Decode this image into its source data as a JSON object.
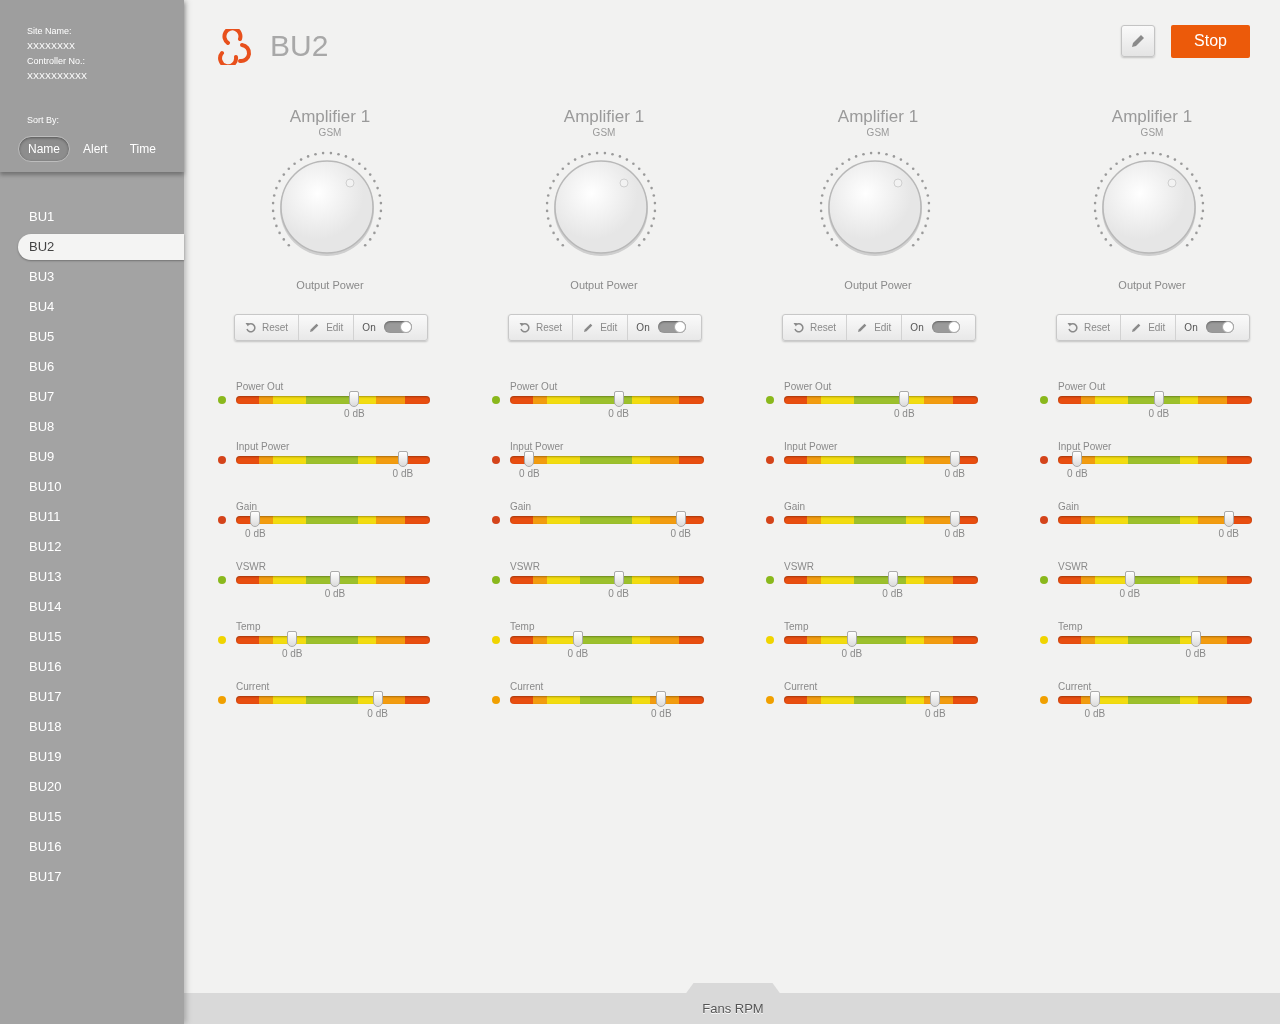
{
  "sidebar": {
    "site_label": "Site Name:",
    "site_value": "XXXXXXXX",
    "controller_label": "Controller No.:",
    "controller_value": "XXXXXXXXXX",
    "sort_label": "Sort By:",
    "sort_options": [
      {
        "label": "Name",
        "selected": true
      },
      {
        "label": "Alert",
        "selected": false
      },
      {
        "label": "Time",
        "selected": false
      }
    ],
    "items": [
      {
        "label": "BU1",
        "selected": false
      },
      {
        "label": "BU2",
        "selected": true
      },
      {
        "label": "BU3",
        "selected": false
      },
      {
        "label": "BU4",
        "selected": false
      },
      {
        "label": "BU5",
        "selected": false
      },
      {
        "label": "BU6",
        "selected": false
      },
      {
        "label": "BU7",
        "selected": false
      },
      {
        "label": "BU8",
        "selected": false
      },
      {
        "label": "BU9",
        "selected": false
      },
      {
        "label": "BU10",
        "selected": false
      },
      {
        "label": "BU11",
        "selected": false
      },
      {
        "label": "BU12",
        "selected": false
      },
      {
        "label": "BU13",
        "selected": false
      },
      {
        "label": "BU14",
        "selected": false
      },
      {
        "label": "BU15",
        "selected": false
      },
      {
        "label": "BU16",
        "selected": false
      },
      {
        "label": "BU17",
        "selected": false
      },
      {
        "label": "BU18",
        "selected": false
      },
      {
        "label": "BU19",
        "selected": false
      },
      {
        "label": "BU20",
        "selected": false
      },
      {
        "label": "BU15",
        "selected": false
      },
      {
        "label": "BU16",
        "selected": false
      },
      {
        "label": "BU17",
        "selected": false
      }
    ]
  },
  "header": {
    "title": "BU2",
    "stop_button": "Stop"
  },
  "amplifiers": [
    {
      "title": "Amplifier 1",
      "subtitle": "GSM",
      "knob_label": "Output Power",
      "reset": "Reset",
      "edit": "Edit",
      "toggle_label": "On",
      "on": true,
      "meters": [
        {
          "name": "Power Out",
          "color": "#8ab81c",
          "level": 0.61,
          "reading": "0 dB"
        },
        {
          "name": "Input Power",
          "color": "#d4441a",
          "level": 0.86,
          "reading": "0 dB"
        },
        {
          "name": "Gain",
          "color": "#d4441a",
          "level": 0.1,
          "reading": "0 dB"
        },
        {
          "name": "VSWR",
          "color": "#8ab81c",
          "level": 0.51,
          "reading": "0 dB"
        },
        {
          "name": "Temp",
          "color": "#f0d400",
          "level": 0.29,
          "reading": "0 dB"
        },
        {
          "name": "Current",
          "color": "#f0a000",
          "level": 0.73,
          "reading": "0 dB"
        }
      ]
    },
    {
      "title": "Amplifier 1",
      "subtitle": "GSM",
      "knob_label": "Output Power",
      "reset": "Reset",
      "edit": "Edit",
      "toggle_label": "On",
      "on": true,
      "meters": [
        {
          "name": "Power Out",
          "color": "#8ab81c",
          "level": 0.56,
          "reading": "0 dB"
        },
        {
          "name": "Input Power",
          "color": "#d4441a",
          "level": 0.1,
          "reading": "0 dB"
        },
        {
          "name": "Gain",
          "color": "#d4441a",
          "level": 0.88,
          "reading": "0 dB"
        },
        {
          "name": "VSWR",
          "color": "#8ab81c",
          "level": 0.56,
          "reading": "0 dB"
        },
        {
          "name": "Temp",
          "color": "#f0d400",
          "level": 0.35,
          "reading": "0 dB"
        },
        {
          "name": "Current",
          "color": "#f0a000",
          "level": 0.78,
          "reading": "0 dB"
        }
      ]
    },
    {
      "title": "Amplifier 1",
      "subtitle": "GSM",
      "knob_label": "Output Power",
      "reset": "Reset",
      "edit": "Edit",
      "toggle_label": "On",
      "on": true,
      "meters": [
        {
          "name": "Power Out",
          "color": "#8ab81c",
          "level": 0.62,
          "reading": "0 dB"
        },
        {
          "name": "Input Power",
          "color": "#d4441a",
          "level": 0.88,
          "reading": "0 dB"
        },
        {
          "name": "Gain",
          "color": "#d4441a",
          "level": 0.88,
          "reading": "0 dB"
        },
        {
          "name": "VSWR",
          "color": "#8ab81c",
          "level": 0.56,
          "reading": "0 dB"
        },
        {
          "name": "Temp",
          "color": "#f0d400",
          "level": 0.35,
          "reading": "0 dB"
        },
        {
          "name": "Current",
          "color": "#f0a000",
          "level": 0.78,
          "reading": "0 dB"
        }
      ]
    },
    {
      "title": "Amplifier 1",
      "subtitle": "GSM",
      "knob_label": "Output Power",
      "reset": "Reset",
      "edit": "Edit",
      "toggle_label": "On",
      "on": true,
      "meters": [
        {
          "name": "Power Out",
          "color": "#8ab81c",
          "level": 0.52,
          "reading": "0 dB"
        },
        {
          "name": "Input Power",
          "color": "#d4441a",
          "level": 0.1,
          "reading": "0 dB"
        },
        {
          "name": "Gain",
          "color": "#d4441a",
          "level": 0.88,
          "reading": "0 dB"
        },
        {
          "name": "VSWR",
          "color": "#8ab81c",
          "level": 0.37,
          "reading": "0 dB"
        },
        {
          "name": "Temp",
          "color": "#f0d400",
          "level": 0.71,
          "reading": "0 dB"
        },
        {
          "name": "Current",
          "color": "#f0a000",
          "level": 0.19,
          "reading": "0 dB"
        }
      ]
    }
  ],
  "footer": {
    "tab": "Fans RPM"
  }
}
